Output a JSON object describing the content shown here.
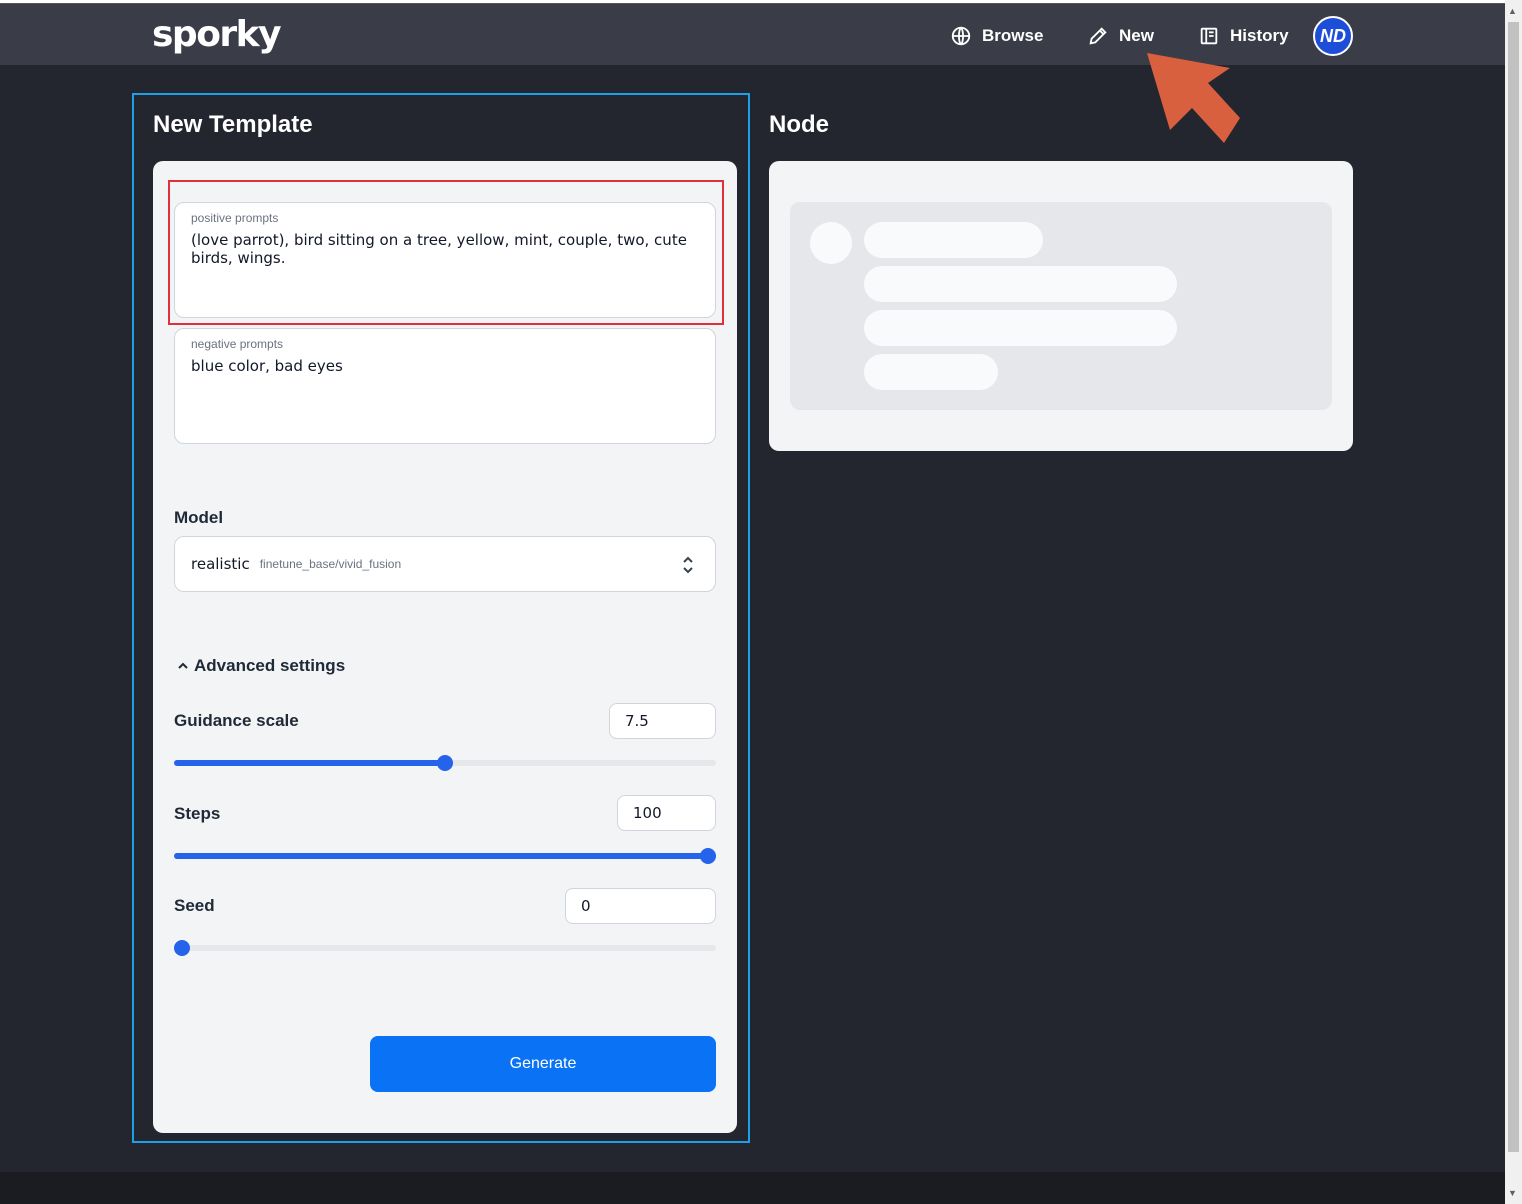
{
  "header": {
    "logo": "sporky",
    "nav": [
      {
        "label": "Browse",
        "icon": "globe-icon"
      },
      {
        "label": "New",
        "icon": "pencil-icon"
      },
      {
        "label": "History",
        "icon": "book-icon"
      }
    ],
    "avatar_initials": "ND"
  },
  "template": {
    "title": "New Template",
    "positive": {
      "label": "positive prompts",
      "value": "(love parrot), bird sitting on a tree, yellow, mint, couple, two, cute birds, wings."
    },
    "negative": {
      "label": "negative prompts",
      "value": "blue color, bad eyes"
    },
    "model": {
      "label": "Model",
      "selected": "realistic",
      "selected_path": "finetune_base/vivid_fusion"
    },
    "advanced": {
      "label": "Advanced settings",
      "guidance": {
        "label": "Guidance scale",
        "value": "7.5",
        "level": 0.5
      },
      "steps": {
        "label": "Steps",
        "value": "100",
        "level": 1.0
      },
      "seed": {
        "label": "Seed",
        "value": "0",
        "level": 0.0
      }
    },
    "generate_label": "Generate"
  },
  "node": {
    "title": "Node"
  },
  "colors": {
    "accent": "#0a72f5",
    "header_bg": "#3a3d48",
    "page_bg": "#23252f",
    "highlight": "#e0303a",
    "focus_frame": "#1ea0e6",
    "arrow": "#d9603e"
  }
}
